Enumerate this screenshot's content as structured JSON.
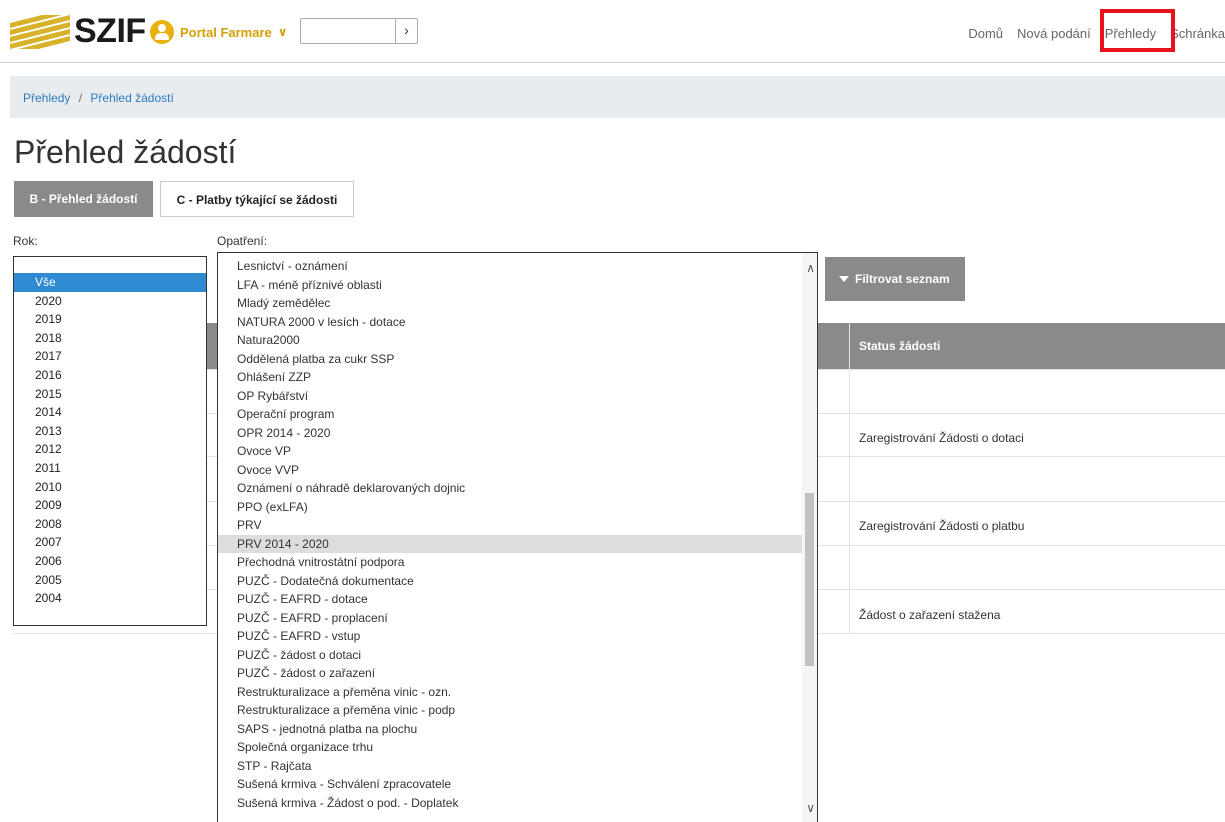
{
  "header": {
    "logo_text": "SZIF",
    "portal_name": "Portal Farmare",
    "nav": [
      "Domů",
      "Nová podání",
      "Přehledy",
      "Schránka"
    ]
  },
  "breadcrumb": {
    "first": "Přehledy",
    "separator": "/",
    "second": "Přehled žádostí"
  },
  "page_title": "Přehled žádostí",
  "tabs": {
    "b": "B - Přehled žádostí",
    "c": "C - Platby týkající se žádosti"
  },
  "filters": {
    "year_label": "Rok:",
    "measure_label": "Opatření:",
    "filter_button": "Filtrovat seznam",
    "year_options": [
      "Vše",
      "2020",
      "2019",
      "2018",
      "2017",
      "2016",
      "2015",
      "2014",
      "2013",
      "2012",
      "2011",
      "2010",
      "2009",
      "2008",
      "2007",
      "2006",
      "2005",
      "2004"
    ],
    "selected_year": "Vše",
    "measure_options": [
      "Lesnictví - oznámení",
      "LFA - méně příznivé oblasti",
      "Mladý zemědělec",
      "NATURA 2000 v lesích - dotace",
      "Natura2000",
      "Oddělená platba za cukr SSP",
      "Ohlášení ZZP",
      "OP Rybářství",
      "Operační program",
      "OPR 2014 - 2020",
      "Ovoce VP",
      "Ovoce VVP",
      "Oznámení o náhradě deklarovaných dojnic",
      "PPO (exLFA)",
      "PRV",
      "PRV 2014 - 2020",
      "Přechodná vnitrostátní podpora",
      "PUZČ - Dodatečná dokumentace",
      "PUZČ - EAFRD - dotace",
      "PUZČ - EAFRD - proplacení",
      "PUZČ - EAFRD - vstup",
      "PUZČ - žádost o dotaci",
      "PUZČ - žádost o zařazení",
      "Restrukturalizace a přeměna vinic - ozn.",
      "Restrukturalizace a přeměna vinic - podp",
      "SAPS - jednotná platba na plochu",
      "Společná organizace trhu",
      "STP - Rajčata",
      "Sušená krmiva - Schválení zpracovatele",
      "Sušená krmiva - Žádost o pod. - Doplatek"
    ],
    "highlighted_measure": "PRV 2014 - 2020"
  },
  "table": {
    "status_header": "Status žádosti",
    "statuses": [
      "",
      "Zaregistrování Žádosti o dotaci",
      "",
      "Zaregistrování Žádosti o platbu",
      "",
      "Žádost o zařazení stažena"
    ]
  }
}
